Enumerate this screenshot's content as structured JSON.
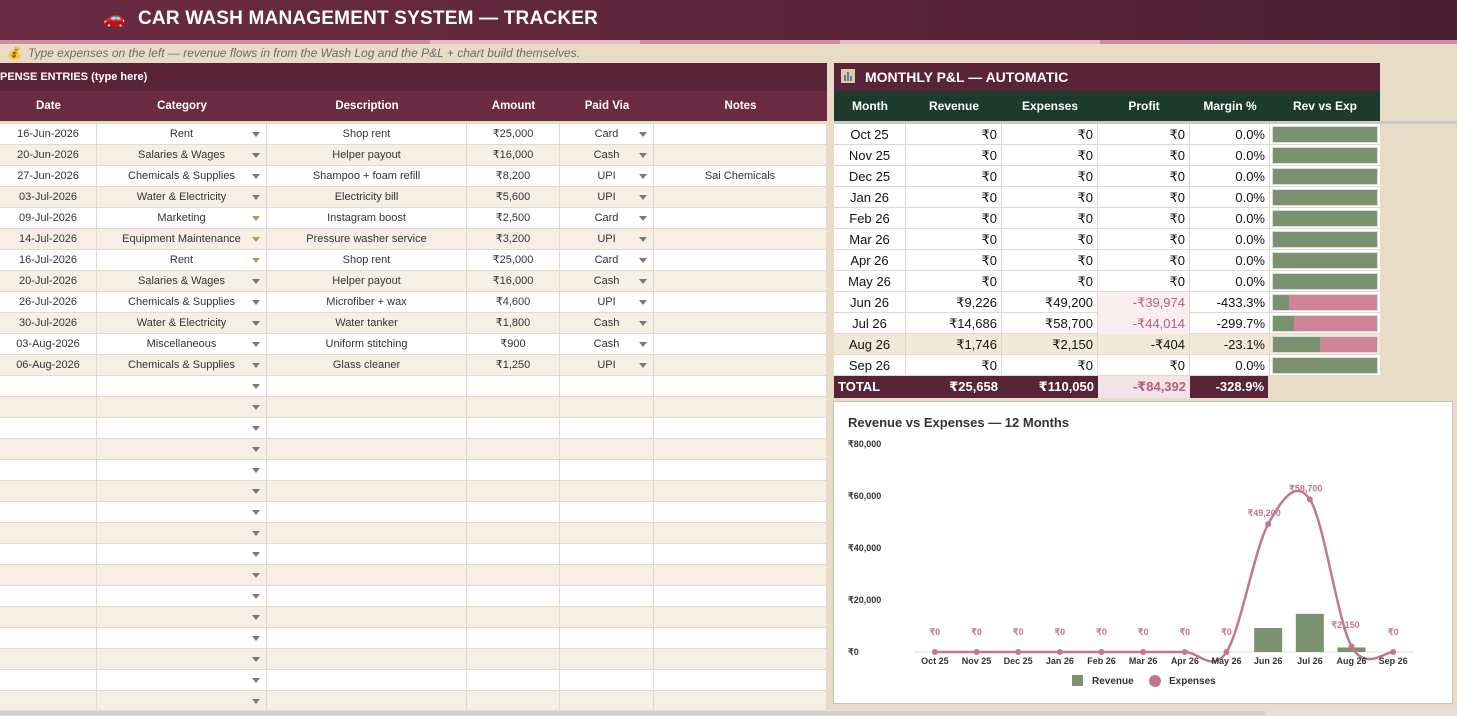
{
  "header": {
    "title": "CAR WASH MANAGEMENT SYSTEM — TRACKER",
    "car_icon": "car-icon"
  },
  "hint": {
    "icon": "money-bag-icon",
    "text": "Type expenses on the left — revenue flows in from the Wash Log and the P&L + chart build themselves."
  },
  "expenses": {
    "section_title": "PENSE ENTRIES (type here)",
    "columns": [
      "Date",
      "Category",
      "Description",
      "Amount",
      "Paid Via",
      "Notes"
    ],
    "rows": [
      {
        "date": "16-Jun-2026",
        "category": "Rent",
        "description": "Shop rent",
        "amount": "₹25,000",
        "paid_via": "Card",
        "notes": ""
      },
      {
        "date": "20-Jun-2026",
        "category": "Salaries & Wages",
        "description": "Helper payout",
        "amount": "₹16,000",
        "paid_via": "Cash",
        "notes": ""
      },
      {
        "date": "27-Jun-2026",
        "category": "Chemicals & Supplies",
        "description": "Shampoo + foam refill",
        "amount": "₹8,200",
        "paid_via": "UPI",
        "notes": "Sai Chemicals"
      },
      {
        "date": "03-Jul-2026",
        "category": "Water & Electricity",
        "description": "Electricity bill",
        "amount": "₹5,600",
        "paid_via": "UPI",
        "notes": ""
      },
      {
        "date": "09-Jul-2026",
        "category": "Marketing",
        "description": "Instagram boost",
        "amount": "₹2,500",
        "paid_via": "Card",
        "notes": ""
      },
      {
        "date": "14-Jul-2026",
        "category": "Equipment Maintenance",
        "description": "Pressure washer service",
        "amount": "₹3,200",
        "paid_via": "UPI",
        "notes": ""
      },
      {
        "date": "16-Jul-2026",
        "category": "Rent",
        "description": "Shop rent",
        "amount": "₹25,000",
        "paid_via": "Card",
        "notes": ""
      },
      {
        "date": "20-Jul-2026",
        "category": "Salaries & Wages",
        "description": "Helper payout",
        "amount": "₹16,000",
        "paid_via": "Cash",
        "notes": ""
      },
      {
        "date": "26-Jul-2026",
        "category": "Chemicals & Supplies",
        "description": "Microfiber + wax",
        "amount": "₹4,600",
        "paid_via": "UPI",
        "notes": ""
      },
      {
        "date": "30-Jul-2026",
        "category": "Water & Electricity",
        "description": "Water tanker",
        "amount": "₹1,800",
        "paid_via": "Cash",
        "notes": ""
      },
      {
        "date": "03-Aug-2026",
        "category": "Miscellaneous",
        "description": "Uniform stitching",
        "amount": "₹900",
        "paid_via": "Cash",
        "notes": ""
      },
      {
        "date": "06-Aug-2026",
        "category": "Chemicals & Supplies",
        "description": "Glass cleaner",
        "amount": "₹1,250",
        "paid_via": "UPI",
        "notes": ""
      }
    ],
    "empty_rows": 16
  },
  "pl": {
    "section_title": "MONTHLY P&L — AUTOMATIC",
    "section_icon": "bar-chart-icon",
    "columns": [
      "Month",
      "Revenue",
      "Expenses",
      "Profit",
      "Margin %",
      "Rev vs Exp"
    ],
    "rows": [
      {
        "month": "Oct 25",
        "revenue": "₹0",
        "expenses": "₹0",
        "profit": "₹0",
        "margin": "0.0%",
        "rev_share": 1.0,
        "negative": false,
        "highlight": false
      },
      {
        "month": "Nov 25",
        "revenue": "₹0",
        "expenses": "₹0",
        "profit": "₹0",
        "margin": "0.0%",
        "rev_share": 1.0,
        "negative": false,
        "highlight": false
      },
      {
        "month": "Dec 25",
        "revenue": "₹0",
        "expenses": "₹0",
        "profit": "₹0",
        "margin": "0.0%",
        "rev_share": 1.0,
        "negative": false,
        "highlight": false
      },
      {
        "month": "Jan 26",
        "revenue": "₹0",
        "expenses": "₹0",
        "profit": "₹0",
        "margin": "0.0%",
        "rev_share": 1.0,
        "negative": false,
        "highlight": false
      },
      {
        "month": "Feb 26",
        "revenue": "₹0",
        "expenses": "₹0",
        "profit": "₹0",
        "margin": "0.0%",
        "rev_share": 1.0,
        "negative": false,
        "highlight": false
      },
      {
        "month": "Mar 26",
        "revenue": "₹0",
        "expenses": "₹0",
        "profit": "₹0",
        "margin": "0.0%",
        "rev_share": 1.0,
        "negative": false,
        "highlight": false
      },
      {
        "month": "Apr 26",
        "revenue": "₹0",
        "expenses": "₹0",
        "profit": "₹0",
        "margin": "0.0%",
        "rev_share": 1.0,
        "negative": false,
        "highlight": false
      },
      {
        "month": "May 26",
        "revenue": "₹0",
        "expenses": "₹0",
        "profit": "₹0",
        "margin": "0.0%",
        "rev_share": 1.0,
        "negative": false,
        "highlight": false
      },
      {
        "month": "Jun 26",
        "revenue": "₹9,226",
        "expenses": "₹49,200",
        "profit": "-₹39,974",
        "margin": "-433.3%",
        "rev_share": 0.158,
        "negative": true,
        "highlight": false
      },
      {
        "month": "Jul 26",
        "revenue": "₹14,686",
        "expenses": "₹58,700",
        "profit": "-₹44,014",
        "margin": "-299.7%",
        "rev_share": 0.2,
        "negative": true,
        "highlight": false
      },
      {
        "month": "Aug 26",
        "revenue": "₹1,746",
        "expenses": "₹2,150",
        "profit": "-₹404",
        "margin": "-23.1%",
        "rev_share": 0.448,
        "negative": false,
        "highlight": true
      },
      {
        "month": "Sep 26",
        "revenue": "₹0",
        "expenses": "₹0",
        "profit": "₹0",
        "margin": "0.0%",
        "rev_share": 1.0,
        "negative": false,
        "highlight": false
      }
    ],
    "total": {
      "label": "TOTAL",
      "revenue": "₹25,658",
      "expenses": "₹110,050",
      "profit": "-₹84,392",
      "margin": "-328.9%"
    }
  },
  "colors": {
    "revenue": "#7a9270",
    "expenses": "#c27691",
    "header_maroon": "#5a2438",
    "header_green": "#1e3a2c"
  },
  "chart_data": {
    "type": "bar",
    "title": "Revenue vs Expenses — 12 Months",
    "categories": [
      "Oct 25",
      "Nov 25",
      "Dec 25",
      "Jan 26",
      "Feb 26",
      "Mar 26",
      "Apr 26",
      "May 26",
      "Jun 26",
      "Jul 26",
      "Aug 26",
      "Sep 26"
    ],
    "series": [
      {
        "name": "Revenue",
        "type": "bar",
        "values": [
          0,
          0,
          0,
          0,
          0,
          0,
          0,
          0,
          9226,
          14686,
          1746,
          0
        ]
      },
      {
        "name": "Expenses",
        "type": "line",
        "values": [
          0,
          0,
          0,
          0,
          0,
          0,
          0,
          0,
          49200,
          58700,
          2150,
          0
        ],
        "data_labels": [
          "₹0",
          "₹0",
          "₹0",
          "₹0",
          "₹0",
          "₹0",
          "₹0",
          "₹0",
          "₹49,200",
          "₹58,700",
          "₹2,150",
          "₹0"
        ]
      }
    ],
    "ylim": [
      0,
      80000
    ],
    "yticks": [
      0,
      20000,
      40000,
      60000,
      80000
    ],
    "ytick_labels": [
      "₹0",
      "₹20,000",
      "₹40,000",
      "₹60,000",
      "₹80,000"
    ],
    "legend": "bottom",
    "grid": false
  }
}
